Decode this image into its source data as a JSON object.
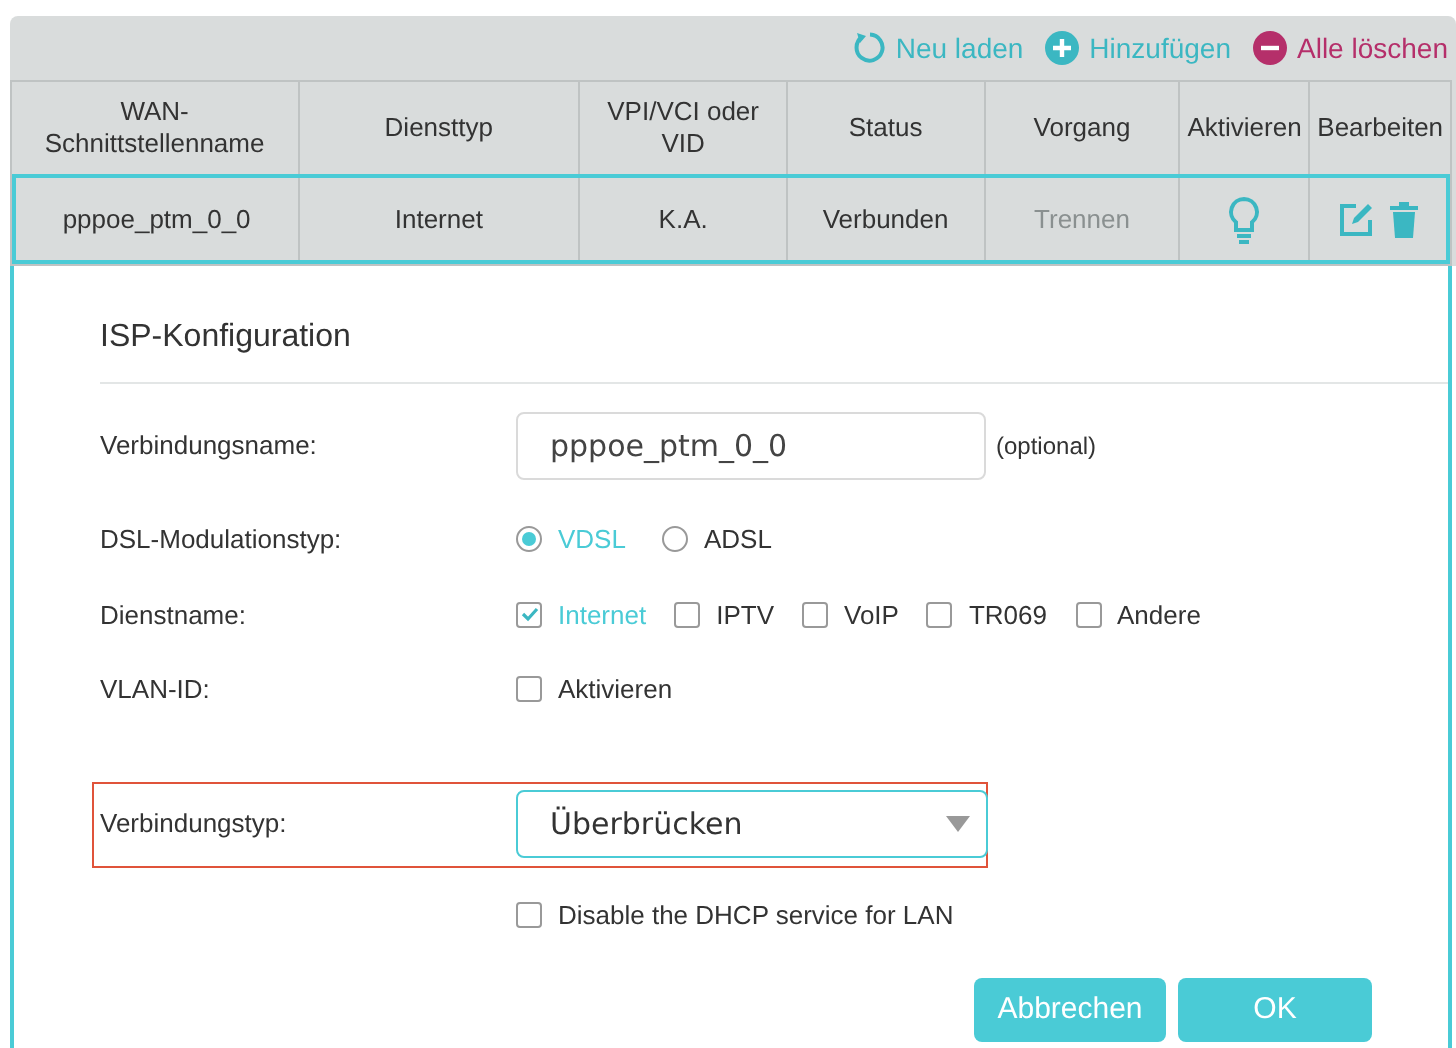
{
  "toolbar": [
    {
      "kind": "reload",
      "label": "Neu laden"
    },
    {
      "kind": "add",
      "label": "Hinzufügen"
    },
    {
      "kind": "delete",
      "label": "Alle löschen"
    }
  ],
  "table": {
    "columns": [
      "WAN-Schnittstellenname",
      "Diensttyp",
      "VPI/VCI oder VID",
      "Status",
      "Vorgang",
      "Aktivieren",
      "Bearbeiten"
    ],
    "rows": [
      {
        "selected": true,
        "interface": "pppoe_ptm_0_0",
        "service_type": "Internet",
        "vpi_vci": "K.A.",
        "status": "Verbunden",
        "action": {
          "label": "Trennen",
          "disabled": true
        }
      }
    ]
  },
  "panel": {
    "title": "ISP-Konfiguration",
    "fields": [
      {
        "kind": "text",
        "label": "Verbindungsname:",
        "value": "pppoe_ptm_0_0",
        "hint": "(optional)"
      },
      {
        "kind": "radio",
        "label": "DSL-Modulationstyp:",
        "options": [
          {
            "label": "VDSL",
            "selected": true
          },
          {
            "label": "ADSL",
            "selected": false
          }
        ]
      },
      {
        "kind": "checks",
        "label": "Dienstname:",
        "options": [
          {
            "label": "Internet",
            "checked": true
          },
          {
            "label": "IPTV",
            "checked": false
          },
          {
            "label": "VoIP",
            "checked": false
          },
          {
            "label": "TR069",
            "checked": false
          },
          {
            "label": "Andere",
            "checked": false
          }
        ]
      },
      {
        "kind": "checks",
        "label": "VLAN-ID:",
        "options": [
          {
            "label": "Aktivieren",
            "checked": false
          }
        ]
      },
      {
        "kind": "select",
        "label": "Verbindungstyp:",
        "value": "Überbrücken",
        "highlighted": true
      },
      {
        "kind": "checks",
        "options": [
          {
            "label": "Disable the DHCP service for LAN",
            "checked": false
          }
        ]
      }
    ],
    "buttons": [
      "Abbrechen",
      "OK"
    ]
  }
}
